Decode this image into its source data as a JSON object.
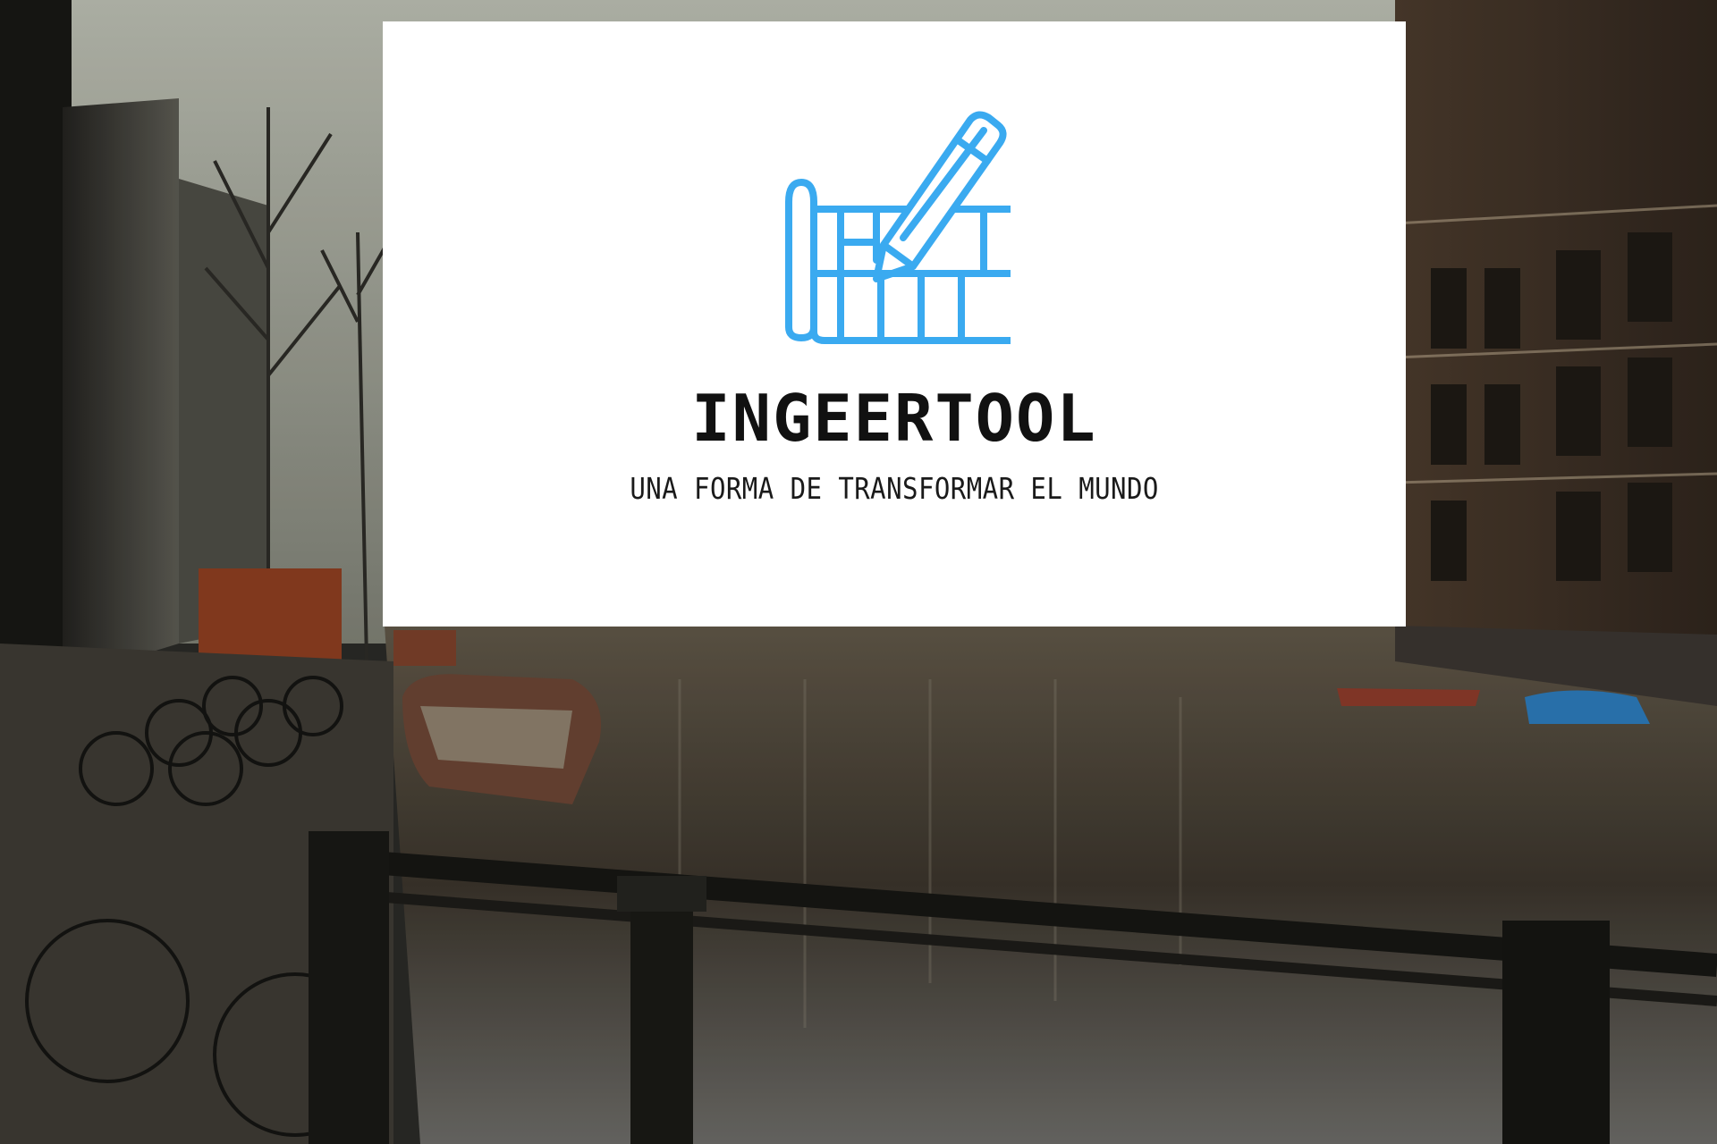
{
  "brand": {
    "name": "INGEERTOOL",
    "tagline": "UNA FORMA DE TRANSFORMAR EL MUNDO",
    "icon": "blueprint-pencil-icon",
    "accent_color": "#3aaaf0"
  },
  "background": {
    "scene": "canal-with-boats-bicycles-and-brick-buildings"
  }
}
